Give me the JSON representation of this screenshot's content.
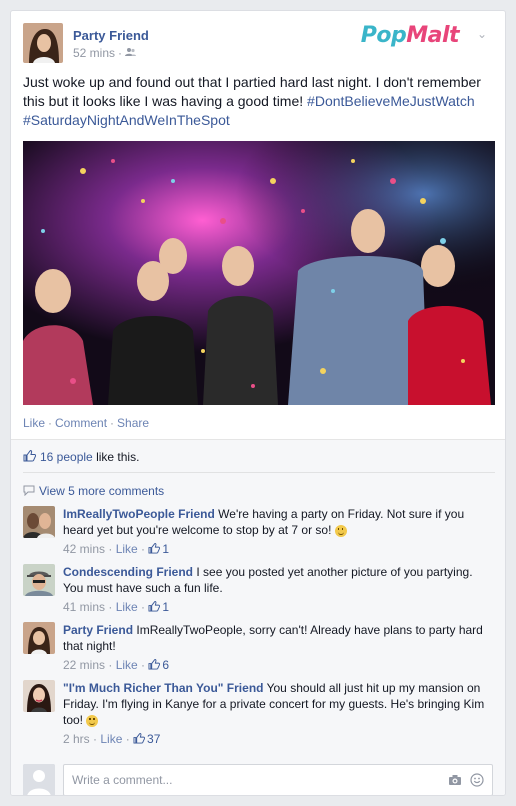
{
  "post": {
    "author": "Party Friend",
    "time": "52 mins",
    "audience_icon": "friends-icon",
    "text": "Just woke up and found out that I partied hard last night. I don't remember this but it looks like I was having a good time! ",
    "hashtags": [
      "#DontBelieveMeJustWatch",
      "#SaturdayNightAndWeInTheSpot"
    ],
    "photo_icon": "party-crowd-photo"
  },
  "brand": {
    "pop": "Pop",
    "malt": "Malt"
  },
  "actions": {
    "like": "Like",
    "comment": "Comment",
    "share": "Share"
  },
  "likes": {
    "count": "16 people",
    "suffix": "like this."
  },
  "view_more": "View 5 more comments",
  "comments": [
    {
      "name": "ImReallyTwoPeople Friend",
      "text": "We're having a party on Friday. Not sure if you heard yet but you're welcome to stop by at 7 or so!",
      "emoji": "smiley-icon",
      "time": "42 mins",
      "like_label": "Like",
      "likes": "1"
    },
    {
      "name": "Condescending Friend",
      "text": "I see you posted yet another picture of you partying. You must have such a fun life.",
      "time": "41 mins",
      "like_label": "Like",
      "likes": "1"
    },
    {
      "name": "Party Friend",
      "text": "ImReallyTwoPeople, sorry can't! Already have plans to party hard that night!",
      "time": "22 mins",
      "like_label": "Like",
      "likes": "6"
    },
    {
      "name": "\"I'm Much Richer Than You\" Friend",
      "text": "You should all just hit up my mansion on Friday. I'm flying in Kanye for a private concert for my guests. He's bringing Kim too!",
      "emoji": "smiley-icon",
      "time": "2 hrs",
      "like_label": "Like",
      "likes": "37"
    }
  ],
  "comment_box": {
    "placeholder": "Write a comment..."
  },
  "colors": {
    "link": "#3b5998",
    "muted": "#9197a3",
    "brand_pop": "#3ab5c9",
    "brand_malt": "#e8457a"
  }
}
